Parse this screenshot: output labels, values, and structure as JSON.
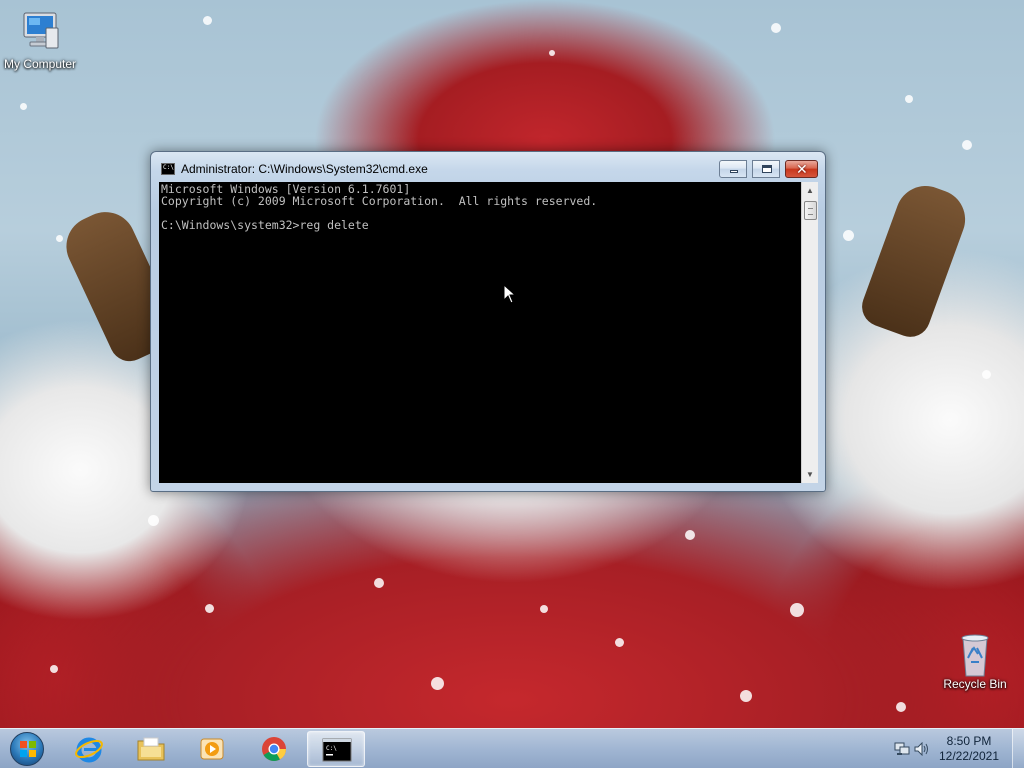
{
  "desktop": {
    "icons": [
      {
        "label": "My Computer",
        "icon": "computer-icon"
      },
      {
        "label": "Recycle Bin",
        "icon": "recycle-bin-icon"
      }
    ]
  },
  "cmd_window": {
    "title": "Administrator: C:\\Windows\\System32\\cmd.exe",
    "console_lines": [
      "Microsoft Windows [Version 6.1.7601]",
      "Copyright (c) 2009 Microsoft Corporation.  All rights reserved.",
      "",
      "C:\\Windows\\system32>reg delete"
    ],
    "buttons": {
      "minimize": "minimize-icon",
      "maximize": "maximize-icon",
      "close": "close-icon"
    },
    "icon_text": "C:\\"
  },
  "taskbar": {
    "start": "windows-start-icon",
    "pinned": [
      {
        "name": "internet-explorer",
        "icon": "internet-explorer-icon"
      },
      {
        "name": "file-explorer",
        "icon": "folder-icon"
      },
      {
        "name": "media-player",
        "icon": "media-player-icon"
      },
      {
        "name": "chrome",
        "icon": "chrome-icon"
      },
      {
        "name": "cmd",
        "icon": "cmd-icon",
        "active": true
      }
    ],
    "tray": {
      "time": "8:50 PM",
      "date": "12/22/2021",
      "icons": [
        "network-icon",
        "volume-icon"
      ]
    }
  },
  "colors": {
    "console_bg": "#000000",
    "console_text": "#c0c0c0",
    "close_button": "#c8361c",
    "taskbar": "#a0bedc"
  }
}
